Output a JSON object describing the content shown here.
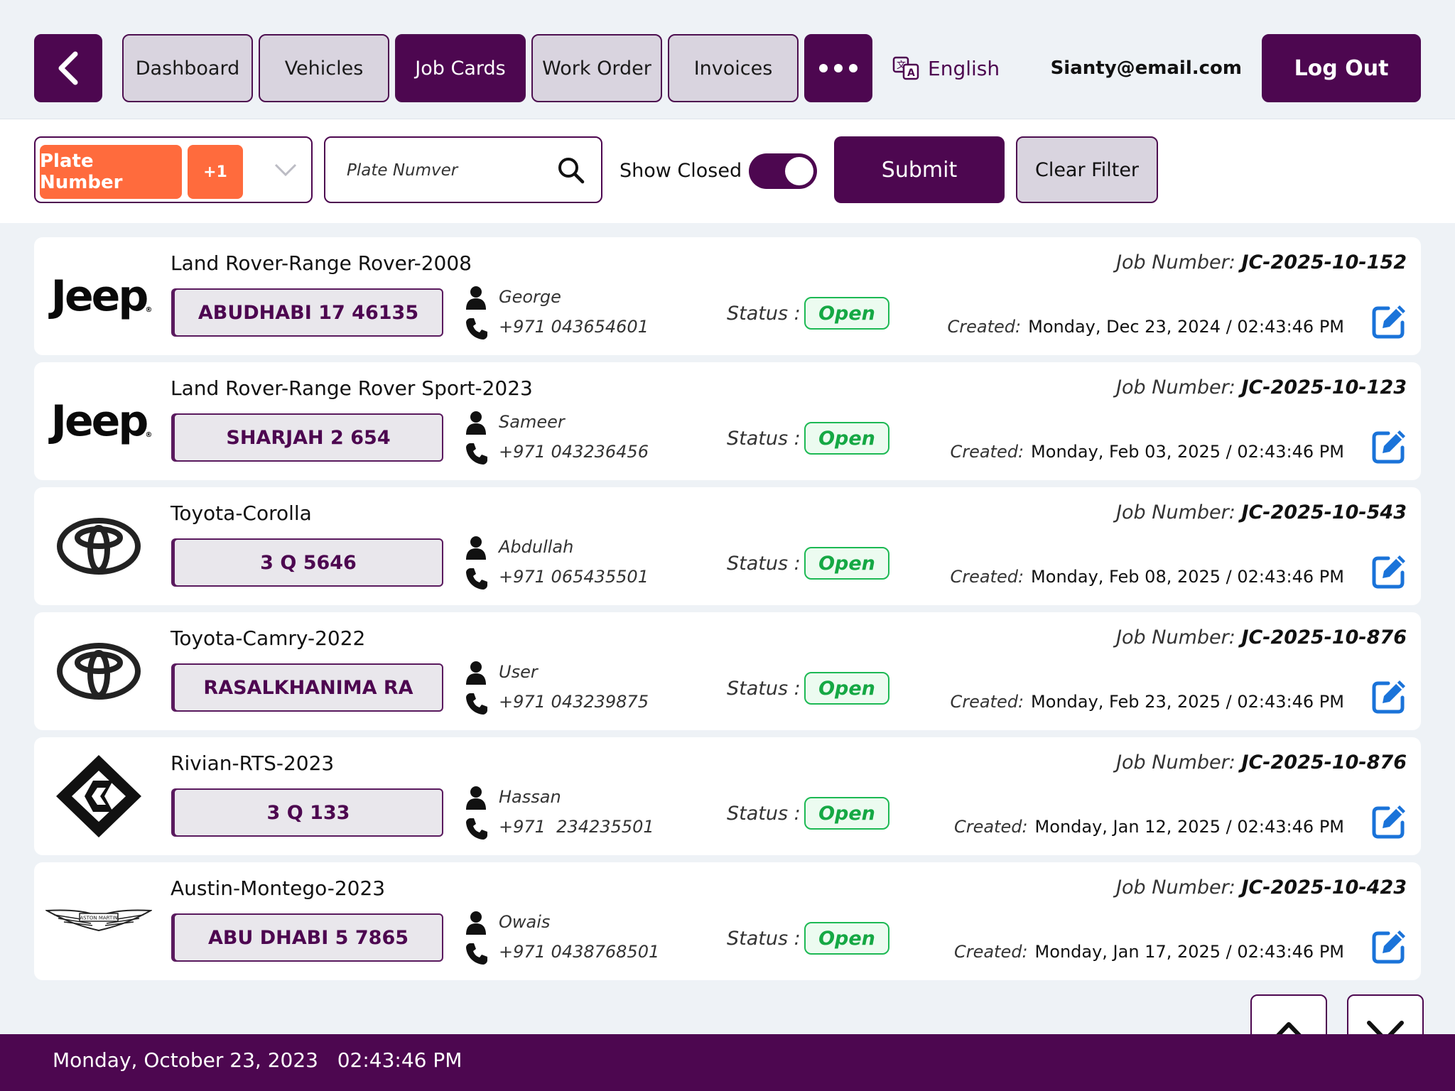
{
  "nav": {
    "tabs": [
      {
        "label": "Dashboard"
      },
      {
        "label": "Vehicles"
      },
      {
        "label": "Job Cards"
      },
      {
        "label": "Work Order"
      },
      {
        "label": "Invoices"
      }
    ],
    "language": "English",
    "user_email": "Sianty@email.com",
    "logout_label": "Log Out"
  },
  "filter": {
    "selected_chip": "Plate Number",
    "extra_count": "+1",
    "search_placeholder": "Plate Numver",
    "show_closed_label": "Show Closed",
    "show_closed_on": true,
    "submit_label": "Submit",
    "clear_label": "Clear Filter"
  },
  "labels": {
    "status": "Status :",
    "job_number": "Job Number:",
    "created": "Created:"
  },
  "jobs": [
    {
      "brand": "jeep",
      "vehicle": "Land Rover-Range Rover-2008",
      "plate": "ABUDHABI 17 46135",
      "customer": "George",
      "phone": "+971 043654601",
      "status": "Open",
      "job_number": "JC-2025-10-152",
      "created": "Monday, Dec 23, 2024 / 02:43:46 PM"
    },
    {
      "brand": "jeep",
      "vehicle": "Land Rover-Range Rover Sport-2023",
      "plate": "SHARJAH 2 654",
      "customer": "Sameer",
      "phone": "+971 043236456",
      "status": "Open",
      "job_number": "JC-2025-10-123",
      "created": "Monday, Feb 03, 2025 / 02:43:46 PM"
    },
    {
      "brand": "toyota",
      "vehicle": "Toyota-Corolla",
      "plate": "3 Q 5646",
      "customer": "Abdullah",
      "phone": "+971 065435501",
      "status": "Open",
      "job_number": "JC-2025-10-543",
      "created": "Monday, Feb 08, 2025 / 02:43:46 PM"
    },
    {
      "brand": "toyota",
      "vehicle": "Toyota-Camry-2022",
      "plate": "RASALKHANIMA RA",
      "customer": "User",
      "phone": "+971 043239875",
      "status": "Open",
      "job_number": "JC-2025-10-876",
      "created": "Monday, Feb 23, 2025 / 02:43:46 PM"
    },
    {
      "brand": "rivian",
      "vehicle": "Rivian-RTS-2023",
      "plate": "3 Q 133",
      "customer": "Hassan",
      "phone": "+971  234235501",
      "status": "Open",
      "job_number": "JC-2025-10-876",
      "created": "Monday, Jan 12, 2025 / 02:43:46 PM"
    },
    {
      "brand": "aston",
      "vehicle": "Austin-Montego-2023",
      "plate": "ABU DHABI 5 7865",
      "customer": "Owais",
      "phone": "+971 0438768501",
      "status": "Open",
      "job_number": "JC-2025-10-423",
      "created": "Monday, Jan 17, 2025 / 02:43:46 PM"
    }
  ],
  "brand_logos": {
    "jeep_text": "Jeep",
    "aston_text": "ASTON MARTIN"
  },
  "footer": {
    "date": "Monday, October 23, 2023",
    "time": "02:43:46 PM"
  },
  "colors": {
    "primary": "#4d0750",
    "chip": "#ff6b3d",
    "status_open": "#15a844",
    "edit_icon": "#1a73d9"
  }
}
